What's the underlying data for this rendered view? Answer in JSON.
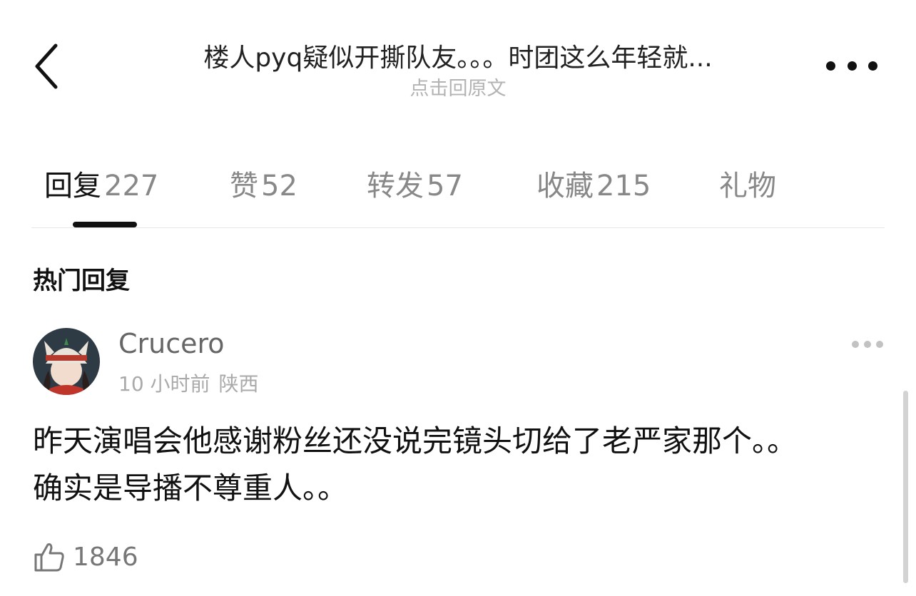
{
  "header": {
    "title": "楼人pyq疑似开撕队友。。。时团这么年轻就...",
    "subtitle": "点击回原文"
  },
  "tabs": [
    {
      "label": "回复",
      "count": "227",
      "active": true
    },
    {
      "label": "赞",
      "count": "52"
    },
    {
      "label": "转发",
      "count": "57"
    },
    {
      "label": "收藏",
      "count": "215"
    },
    {
      "label": "礼物",
      "count": ""
    }
  ],
  "section_title": "热门回复",
  "comment": {
    "username": "Crucero",
    "time": "10 小时前",
    "location": "陕西",
    "text": "昨天演唱会他感谢粉丝还没说完镜头切给了老严家那个。。确实是导播不尊重人。。",
    "likes": "1846"
  },
  "icons": {
    "back": "chevron-left-icon",
    "more": "more-dots-icon",
    "like": "thumbs-up-icon"
  },
  "colors": {
    "background": "#ffffff",
    "primary_text": "#111111",
    "secondary_text": "#888888",
    "muted_text": "#b3b3b3"
  }
}
